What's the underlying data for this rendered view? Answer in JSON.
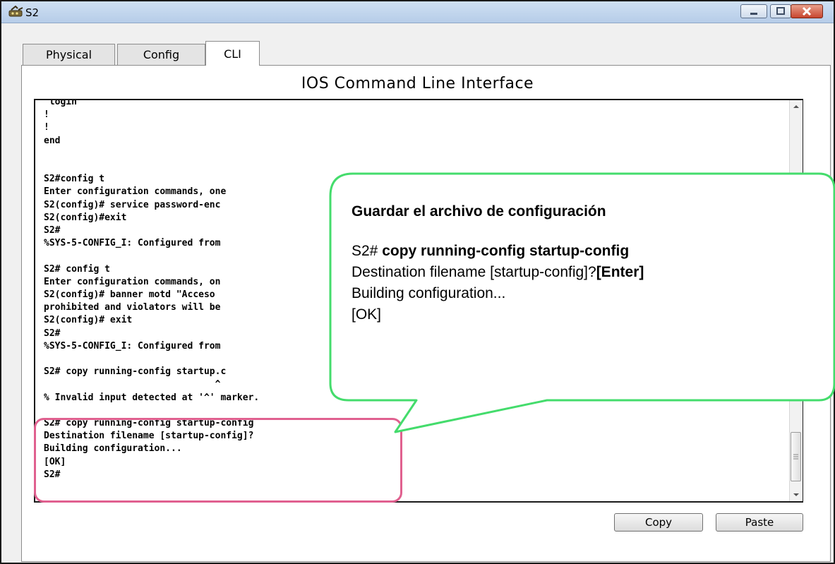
{
  "window": {
    "title": "S2",
    "minimize_label": "",
    "maximize_label": "",
    "close_label": ""
  },
  "tabs": [
    {
      "label": "Physical"
    },
    {
      "label": "Config"
    },
    {
      "label": "CLI"
    }
  ],
  "cli": {
    "heading": "IOS Command Line Interface",
    "lines": [
      " login",
      "!",
      "!",
      "end",
      "",
      "",
      "S2#config t",
      "Enter configuration commands, one",
      "S2(config)# service password-enc",
      "S2(config)#exit",
      "S2#",
      "%SYS-5-CONFIG_I: Configured from",
      "",
      "S2# config t",
      "Enter configuration commands, on",
      "S2(config)# banner motd \"Acceso",
      "prohibited and violators will be",
      "S2(config)# exit",
      "S2#",
      "%SYS-5-CONFIG_I: Configured from",
      "",
      "S2# copy running-config startup.c",
      "                               ^",
      "% Invalid input detected at '^' marker.",
      "",
      "S2# copy running-config startup-config",
      "Destination filename [startup-config]?",
      "Building configuration...",
      "[OK]",
      "S2#"
    ]
  },
  "buttons": {
    "copy": "Copy",
    "paste": "Paste"
  },
  "callout": {
    "title": "Guardar el archivo de configuración",
    "prompt": "S2# ",
    "command": "copy running-config startup-config",
    "destination_prefix": "Destination filename [startup-config]?",
    "destination_key": "[Enter]",
    "building": "Building configuration...",
    "ok": "[OK]"
  },
  "colors": {
    "callout_border": "#44dc6c",
    "highlight_border": "#e0608f",
    "titlebar": "#c4d7ee",
    "close_button": "#c8462e"
  },
  "icons": {
    "app": "network-switch-icon",
    "minimize": "minimize-icon",
    "maximize": "maximize-icon",
    "close": "close-icon",
    "scroll_up": "chevron-up-icon",
    "scroll_down": "chevron-down-icon"
  }
}
